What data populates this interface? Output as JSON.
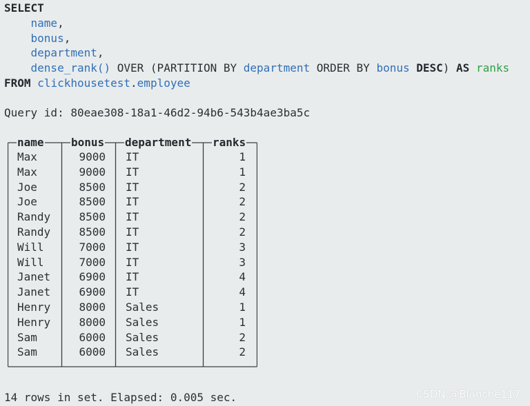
{
  "query": {
    "select_kw": "SELECT",
    "col_name": "name",
    "col_bonus": "bonus",
    "col_department": "department",
    "fn": "dense_rank()",
    "over": " OVER (PARTITION BY ",
    "partition_col": "department",
    "order_by": " ORDER BY ",
    "order_col": "bonus",
    "desc_kw": "DESC",
    "close_paren": ") ",
    "as_kw": "AS",
    "alias": "ranks",
    "comma": ",",
    "from_kw": "FROM",
    "db": "clickhousetest",
    "dot": ".",
    "table": "employee"
  },
  "query_id_line": "Query id: 80eae308-18a1-46d2-94b6-543b4ae3ba5c",
  "result": {
    "headers": [
      "name",
      "bonus",
      "department",
      "ranks"
    ],
    "rows": [
      [
        "Max",
        "9000",
        "IT",
        "1"
      ],
      [
        "Max",
        "9000",
        "IT",
        "1"
      ],
      [
        "Joe",
        "8500",
        "IT",
        "2"
      ],
      [
        "Joe",
        "8500",
        "IT",
        "2"
      ],
      [
        "Randy",
        "8500",
        "IT",
        "2"
      ],
      [
        "Randy",
        "8500",
        "IT",
        "2"
      ],
      [
        "Will",
        "7000",
        "IT",
        "3"
      ],
      [
        "Will",
        "7000",
        "IT",
        "3"
      ],
      [
        "Janet",
        "6900",
        "IT",
        "4"
      ],
      [
        "Janet",
        "6900",
        "IT",
        "4"
      ],
      [
        "Henry",
        "8000",
        "Sales",
        "1"
      ],
      [
        "Henry",
        "8000",
        "Sales",
        "1"
      ],
      [
        "Sam",
        "6000",
        "Sales",
        "2"
      ],
      [
        "Sam",
        "6000",
        "Sales",
        "2"
      ]
    ]
  },
  "footer": "14 rows in set. Elapsed: 0.005 sec.",
  "watermark": "CSDN @Blanche117",
  "colors": {
    "background": "#e9eced",
    "keyword": "#24292e",
    "identifier": "#2f6fb7",
    "alias": "#2ea043",
    "text": "#2b2f33"
  }
}
